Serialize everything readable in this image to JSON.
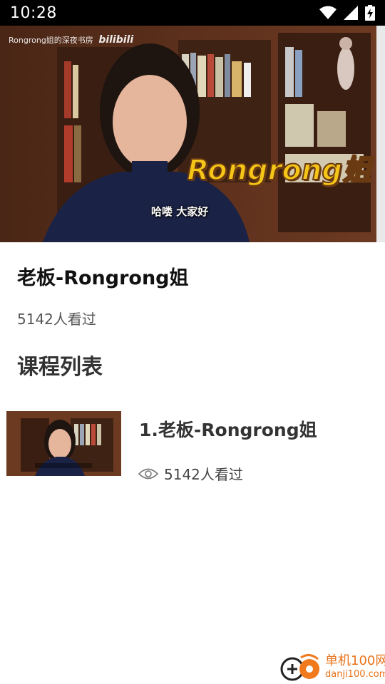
{
  "status_bar": {
    "time": "10:28",
    "icons": [
      "wifi-icon",
      "cell-signal-icon",
      "battery-charging-icon"
    ]
  },
  "video": {
    "watermark_text": "Rongrong姐的深夜书房",
    "watermark_brand": "bilibili",
    "overlay_name": "Rongrong姐",
    "subtitle": "哈喽 大家好"
  },
  "course": {
    "title": "老板-Rongrong姐",
    "views": "5142人看过"
  },
  "section": {
    "heading": "课程列表"
  },
  "lessons": [
    {
      "title": "1.老板-Rongrong姐",
      "views": "5142人看过",
      "icon": "eye-icon"
    }
  ],
  "site_logo": {
    "name": "单机100网",
    "domain": "danji100.com"
  },
  "colors": {
    "status_bar_bg": "#000000",
    "overlay_yellow": "#f5c518",
    "logo_orange": "#e8731a"
  }
}
